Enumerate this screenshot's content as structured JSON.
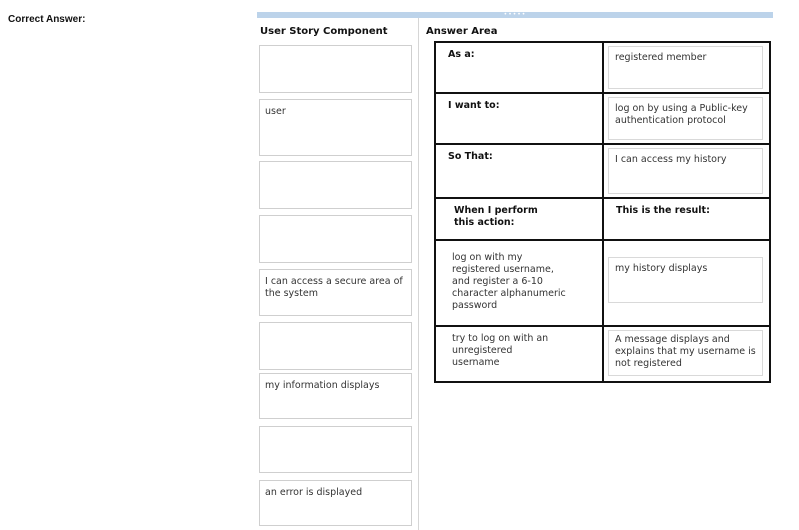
{
  "header": {
    "title": "Correct Answer:"
  },
  "left_panel": {
    "heading": "User Story Component",
    "slots": [
      {
        "text": ""
      },
      {
        "text": "user"
      },
      {
        "text": ""
      },
      {
        "text": ""
      },
      {
        "text": "I can access a secure area of the system"
      },
      {
        "text": ""
      },
      {
        "text": "my information displays"
      },
      {
        "text": ""
      },
      {
        "text": "an error is displayed"
      }
    ]
  },
  "answer_area": {
    "heading": "Answer Area",
    "rows": [
      {
        "label": "As a:",
        "value": "registered member"
      },
      {
        "label": "I want to:",
        "value": "log on by using a Public-key authentication protocol"
      },
      {
        "label": "So That:",
        "value": "I can access my history"
      }
    ],
    "scenario_header": {
      "action": "When I perform this action:",
      "result": "This is the result:"
    },
    "scenarios": [
      {
        "action": "log on with my registered username, and register a 6-10 character alphanumeric password",
        "result": "my history displays"
      },
      {
        "action": "try to log on with an unregistered username",
        "result": "A message displays and explains that my username is not registered"
      }
    ]
  }
}
